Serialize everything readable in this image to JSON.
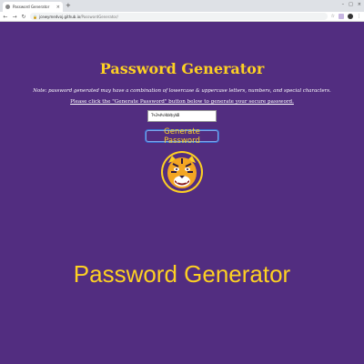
{
  "browser": {
    "tab_title": "Password Generator",
    "tab_close": "×",
    "new_tab": "+",
    "url_host": "jcewymedvoj.github.io",
    "url_path": "/PasswordGenerator/",
    "window_controls": [
      "–",
      "□",
      "×"
    ]
  },
  "page": {
    "title": "Password Generator",
    "note": "Note: password generated may have a combination of lowercase & uppercase letters, numbers, and special characters.",
    "instruction": "Please click the \"Generate Password\" button below to generate your secure password.",
    "password_value": "T%3%#vHbW$yWB",
    "generate_button": "Generate Password"
  },
  "caption": "Password Generator",
  "colors": {
    "background": "#522d80",
    "accent_gold": "#fdd023",
    "button_outline": "#7fa7e8"
  },
  "icons": {
    "mascot": "tiger-head-icon"
  }
}
